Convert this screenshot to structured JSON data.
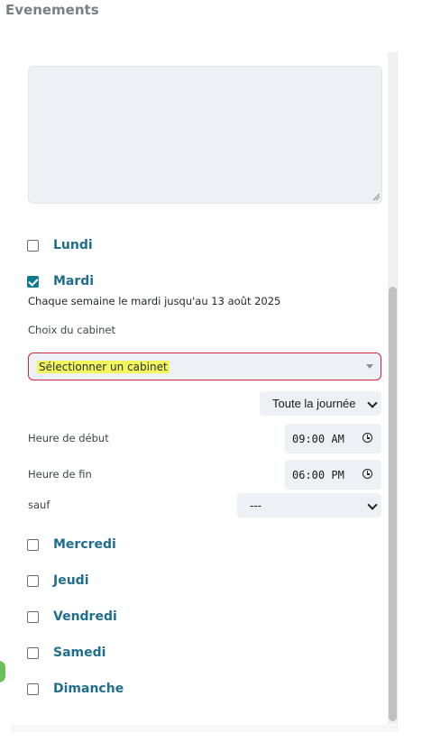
{
  "page": {
    "title": "Evenements"
  },
  "days": {
    "lundi": {
      "label": "Lundi",
      "checked": false
    },
    "mardi": {
      "label": "Mardi",
      "checked": true
    },
    "mercredi": {
      "label": "Mercredi",
      "checked": false
    },
    "jeudi": {
      "label": "Jeudi",
      "checked": false
    },
    "vendredi": {
      "label": "Vendredi",
      "checked": false
    },
    "samedi": {
      "label": "Samedi",
      "checked": false
    },
    "dimanche": {
      "label": "Dimanche",
      "checked": false
    }
  },
  "mardi_detail": {
    "recurrence_text": "Chaque semaine le mardi jusqu'au 13 août 2025",
    "cabinet_label": "Choix du cabinet",
    "cabinet_select_value": "Sélectionner un cabinet",
    "day_mode_value": "Toute la journée",
    "start_label": "Heure de début",
    "start_value": "09:00 AM",
    "end_label": "Heure de fin",
    "end_value": "06:00 PM",
    "except_label": "sauf",
    "except_value": "---"
  },
  "colors": {
    "accent": "#1f6e8f",
    "checkbox_checked": "#0f7b91",
    "error_border": "#d0283a",
    "highlight": "#f4f75a",
    "field_bg": "#edf0f4"
  }
}
